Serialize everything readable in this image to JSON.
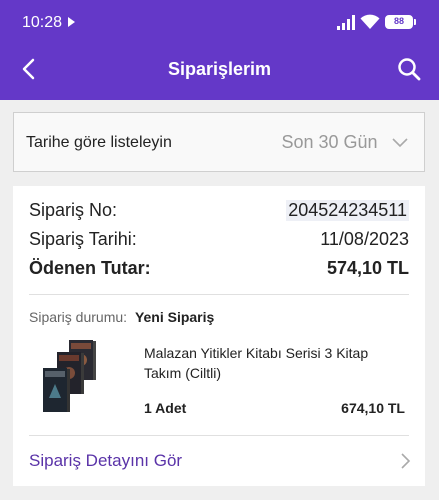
{
  "status_bar": {
    "time": "10:28",
    "battery": "88"
  },
  "header": {
    "title": "Siparişlerim",
    "icons": {
      "back": "chevron-left-icon",
      "search": "search-icon"
    },
    "color": "#6438c8"
  },
  "filter": {
    "label": "Tarihe göre listeleyin",
    "selected": "Son 30 Gün"
  },
  "order": {
    "order_no_label": "Sipariş No:",
    "order_no": "204524234511",
    "date_label": "Sipariş Tarihi:",
    "date": "11/08/2023",
    "paid_label": "Ödenen Tutar:",
    "paid": "574,10 TL",
    "status_label": "Sipariş durumu:",
    "status": "Yeni Sipariş",
    "item": {
      "name": "Malazan Yitikler Kitabı Serisi 3 Kitap Takım (Ciltli)",
      "quantity": "1 Adet",
      "price": "674,10 TL"
    },
    "detail_link": "Sipariş Detayını Gör"
  }
}
